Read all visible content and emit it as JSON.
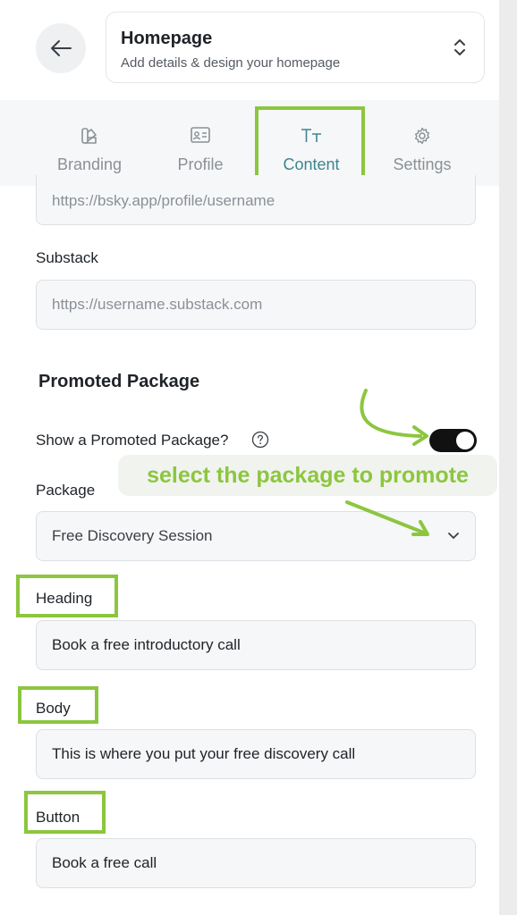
{
  "header": {
    "back_icon": "arrow-left-icon",
    "title": "Homepage",
    "subtitle": "Add details & design your homepage",
    "selector_icon": "chevron-up-down-icon"
  },
  "tabs": [
    {
      "label": "Branding",
      "icon": "palette-icon",
      "active": false
    },
    {
      "label": "Profile",
      "icon": "id-card-icon",
      "active": false
    },
    {
      "label": "Content",
      "icon": "text-size-icon",
      "active": true
    },
    {
      "label": "Settings",
      "icon": "gear-icon",
      "active": false
    }
  ],
  "form": {
    "bluesky_placeholder": "https://bsky.app/profile/username",
    "substack_label": "Substack",
    "substack_placeholder": "https://username.substack.com",
    "promoted_title": "Promoted Package",
    "show_promoted_label": "Show a Promoted Package?",
    "show_promoted_on": true,
    "package_label": "Package",
    "package_value": "Free Discovery Session",
    "heading_label": "Heading",
    "heading_value": "Book a free introductory call",
    "body_label": "Body",
    "body_value": "This is where you put your free discovery call",
    "button_label": "Button",
    "button_value": "Book a free call"
  },
  "annotation": {
    "callout_text": "select the package to promote",
    "highlight_color": "#8cc63f"
  },
  "colors": {
    "accent_teal": "#3c8591",
    "toggle_on": "#111111"
  }
}
